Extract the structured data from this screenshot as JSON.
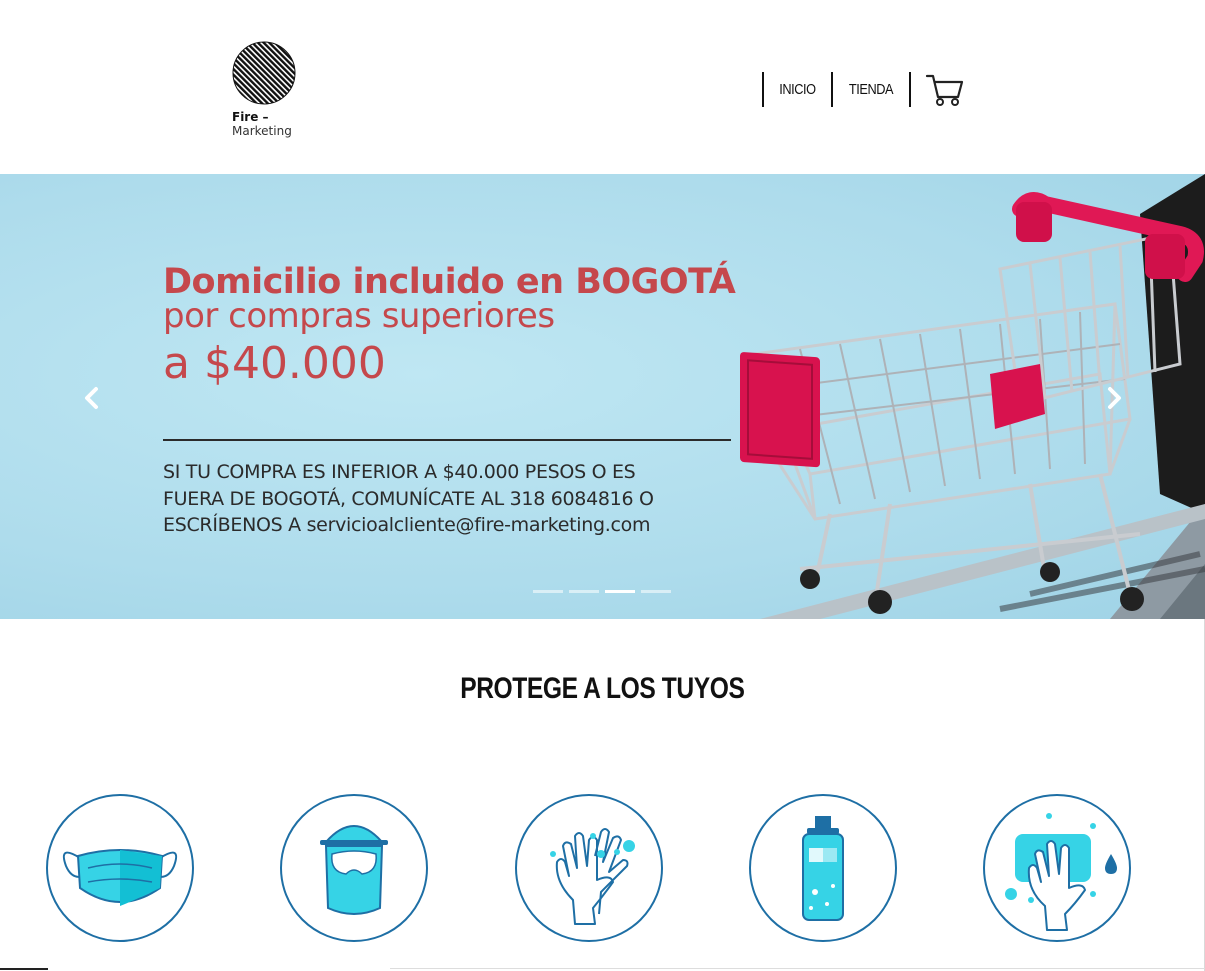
{
  "brand": {
    "name": "Fire –",
    "sub": "Marketing"
  },
  "nav": {
    "items": [
      {
        "label": "INICIO"
      },
      {
        "label": "TIENDA"
      }
    ],
    "cart_icon": "shopping-cart-icon"
  },
  "hero": {
    "title": "Domicilio incluido en BOGOTÁ",
    "subtitle_line1": "por compras superiores",
    "subtitle_line2": "a $40.000",
    "body_lines": [
      "SI TU COMPRA ES INFERIOR A $40.000 PESOS O ES",
      "FUERA DE BOGOTÁ, COMUNÍCATE AL 318 6084816 O",
      "ESCRÍBENOS A servicioalcliente@fire-marketing.com"
    ],
    "active_slide": 3,
    "slide_count": 4,
    "colors": {
      "accent": "#c5484c",
      "background": "#b2e0ee"
    }
  },
  "section": {
    "title": "PROTEGE A LOS TUYOS",
    "icons": [
      {
        "name": "face-mask-icon"
      },
      {
        "name": "face-shield-icon"
      },
      {
        "name": "hand-washing-icon"
      },
      {
        "name": "sanitizer-bottle-icon"
      },
      {
        "name": "hand-wipe-icon"
      }
    ],
    "colors": {
      "outline": "#1e6fa5",
      "fill": "#36d3e6"
    }
  }
}
